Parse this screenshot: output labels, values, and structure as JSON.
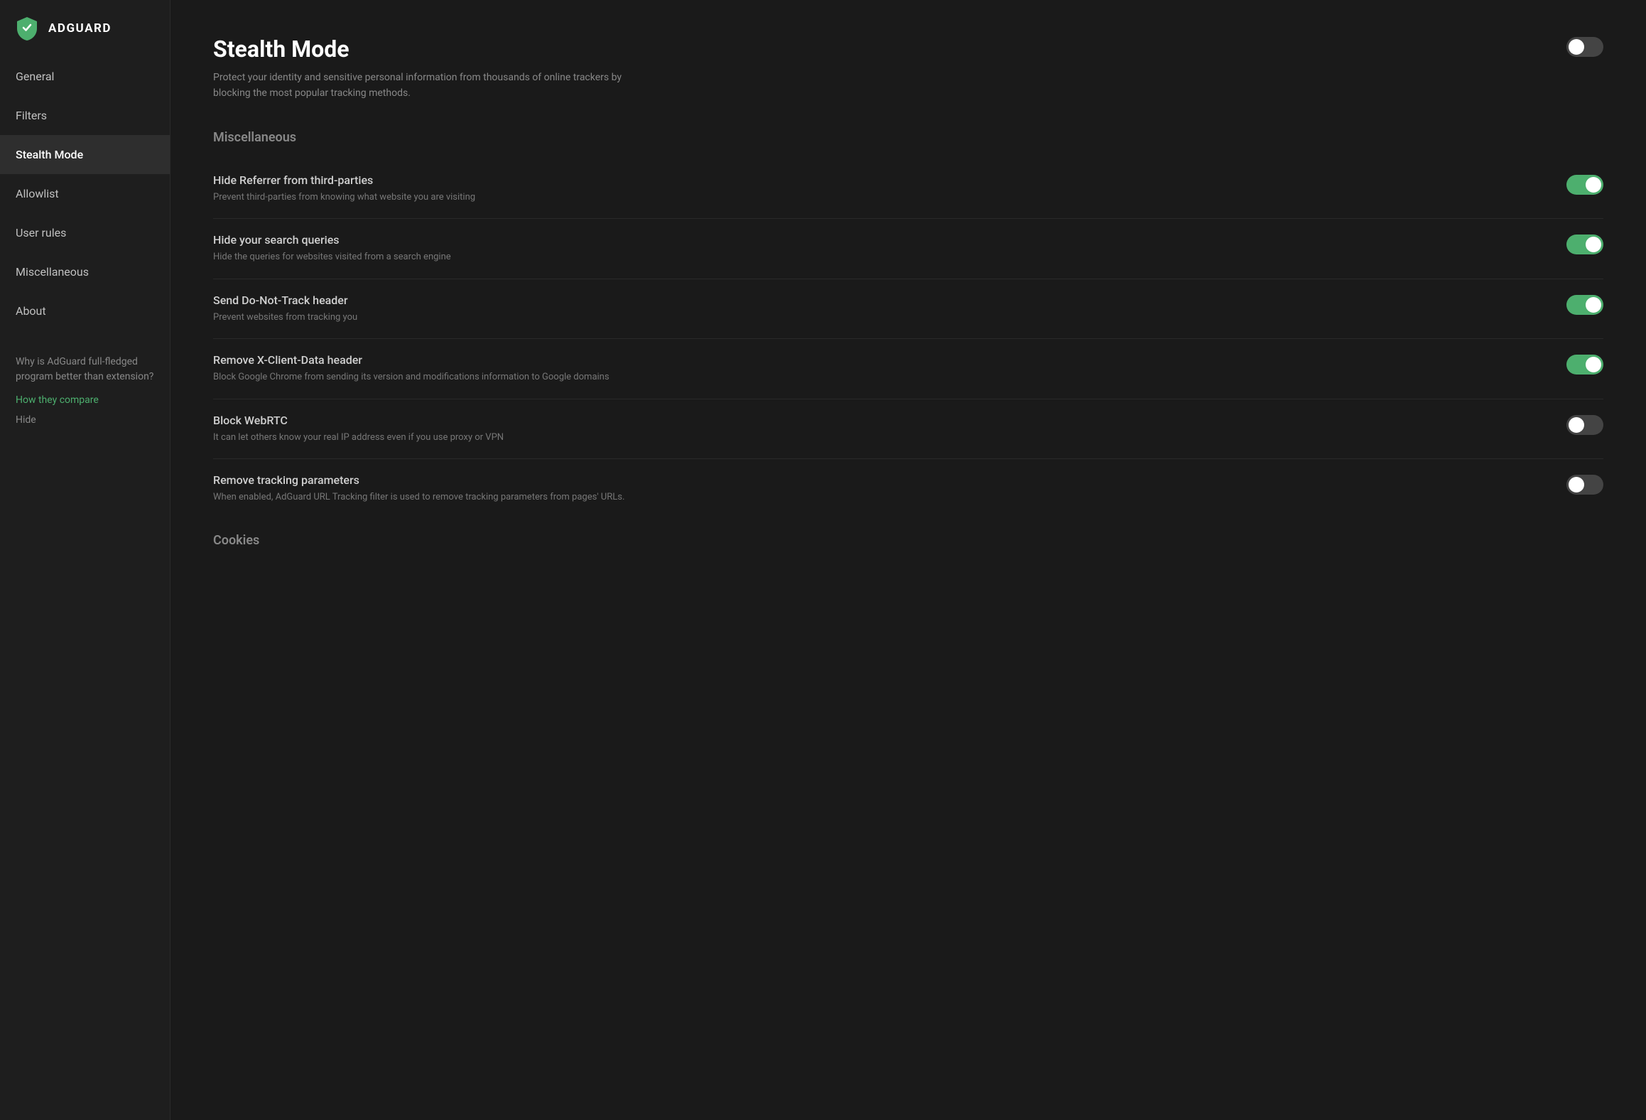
{
  "logo": {
    "text": "ADGUARD"
  },
  "sidebar": {
    "items": [
      {
        "id": "general",
        "label": "General",
        "active": false
      },
      {
        "id": "filters",
        "label": "Filters",
        "active": false
      },
      {
        "id": "stealth-mode",
        "label": "Stealth Mode",
        "active": true
      },
      {
        "id": "allowlist",
        "label": "Allowlist",
        "active": false
      },
      {
        "id": "user-rules",
        "label": "User rules",
        "active": false
      },
      {
        "id": "miscellaneous",
        "label": "Miscellaneous",
        "active": false
      },
      {
        "id": "about",
        "label": "About",
        "active": false
      }
    ],
    "promo_text": "Why is AdGuard full-fledged program better than extension?",
    "promo_link": "How they compare",
    "hide_label": "Hide"
  },
  "page": {
    "title": "Stealth Mode",
    "description": "Protect your identity and sensitive personal information from thousands of online trackers by blocking the most popular tracking methods.",
    "master_toggle": "off"
  },
  "sections": [
    {
      "id": "miscellaneous",
      "title": "Miscellaneous",
      "settings": [
        {
          "id": "hide-referrer",
          "title": "Hide Referrer from third-parties",
          "description": "Prevent third-parties from knowing what website you are visiting",
          "toggle": "on"
        },
        {
          "id": "hide-search-queries",
          "title": "Hide your search queries",
          "description": "Hide the queries for websites visited from a search engine",
          "toggle": "on"
        },
        {
          "id": "do-not-track",
          "title": "Send Do-Not-Track header",
          "description": "Prevent websites from tracking you",
          "toggle": "on"
        },
        {
          "id": "remove-x-client",
          "title": "Remove X-Client-Data header",
          "description": "Block Google Chrome from sending its version and modifications information to Google domains",
          "toggle": "on"
        },
        {
          "id": "block-webrtc",
          "title": "Block WebRTC",
          "description": "It can let others know your real IP address even if you use proxy or VPN",
          "toggle": "off"
        },
        {
          "id": "remove-tracking-params",
          "title": "Remove tracking parameters",
          "description": "When enabled, AdGuard URL Tracking filter is used to remove tracking parameters from pages' URLs.",
          "toggle": "off"
        }
      ]
    },
    {
      "id": "cookies",
      "title": "Cookies",
      "settings": []
    }
  ]
}
